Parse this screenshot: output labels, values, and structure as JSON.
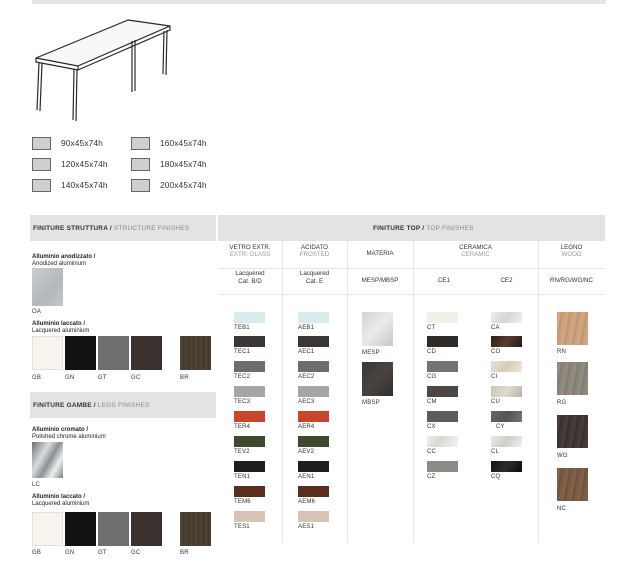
{
  "sizes": [
    "90x45x74h",
    "120x45x74h",
    "140x45x74h",
    "160x45x74h",
    "180x45x74h",
    "200x45x74h"
  ],
  "structure_bar": {
    "it": "FINITURE STRUTTURA /",
    "en": " STRUCTURE FINISHES"
  },
  "top_bar": {
    "it": "FINITURE TOP /",
    "en": " TOP FINISHES"
  },
  "legs_bar": {
    "it": "FINITURE GAMBE /",
    "en": " LEGS FINISHES"
  },
  "columns": {
    "vetro": {
      "title": "VETRO EXTR.",
      "en": "EXTR. GLASS",
      "sub1": "Lacquered",
      "sub2": "Cat. B/D"
    },
    "acidato": {
      "title": "ACIDATO",
      "en": "FROSTED",
      "sub1": "Lacquered",
      "sub2": "Cat. E"
    },
    "materia": {
      "title": "MATERIA",
      "sub": "MESP/MBSP"
    },
    "ceramica": {
      "title": "CERAMICA",
      "en": "CERAMIC",
      "ce1": "CE1",
      "ce2": "CE2"
    },
    "legno": {
      "title": "LEGNO",
      "en": "WOOD",
      "sub": "RN/RG/WG/NC"
    }
  },
  "structure": {
    "anod_title": "Alluminio anodizzato /",
    "anod_en": "Anodized aluminium",
    "anod_code": "OA",
    "lacq_title": "Alluminio laccato /",
    "lacq_en": "Lacquered aluminium",
    "lacq_codes": [
      "GB",
      "GN",
      "GT",
      "GC",
      "BR"
    ]
  },
  "legs": {
    "chrome_title": "Alluminio cromato /",
    "chrome_en": "Polished chrome aluminium",
    "chrome_code": "LC",
    "lacq_title": "Alluminio laccato /",
    "lacq_en": "Lacquered aluminium",
    "lacq_codes": [
      "GB",
      "GN",
      "GT",
      "GC",
      "BR"
    ]
  },
  "vetro_codes": [
    "TEB1",
    "TEC1",
    "TEC2",
    "TEC3",
    "TER4",
    "TEV2",
    "TEN1",
    "TEM6",
    "TES1"
  ],
  "acidato_codes": [
    "AEB1",
    "AEC1",
    "AEC2",
    "AEC3",
    "AER4",
    "AEV2",
    "AEN1",
    "AEM6",
    "AES1"
  ],
  "materia_codes": [
    "MESP",
    "MBSP"
  ],
  "ce1_codes": [
    "CT",
    "CD",
    "CG",
    "CM",
    "CX",
    "CC",
    "CZ"
  ],
  "ce2_codes": [
    "CA",
    "CO",
    "CI",
    "CU",
    "CY",
    "CL",
    "CQ"
  ],
  "legno_codes": [
    "RN",
    "RG",
    "WG",
    "NC"
  ],
  "colors": {
    "glass": [
      "#d9eaec",
      "#3a3537",
      "#6f6c6b",
      "#a6a6a6",
      "#c8452c",
      "#3e4a2c",
      "#1e1e20",
      "#5a2d1c",
      "#d6c4b6"
    ],
    "structure": [
      "#f6f4ec",
      "#111111",
      "#6e6e6e",
      "#3a302c",
      "#4a3e34"
    ],
    "wood": [
      "#caa07a",
      "#8b857c",
      "#3f3733",
      "#7a5a44"
    ]
  }
}
